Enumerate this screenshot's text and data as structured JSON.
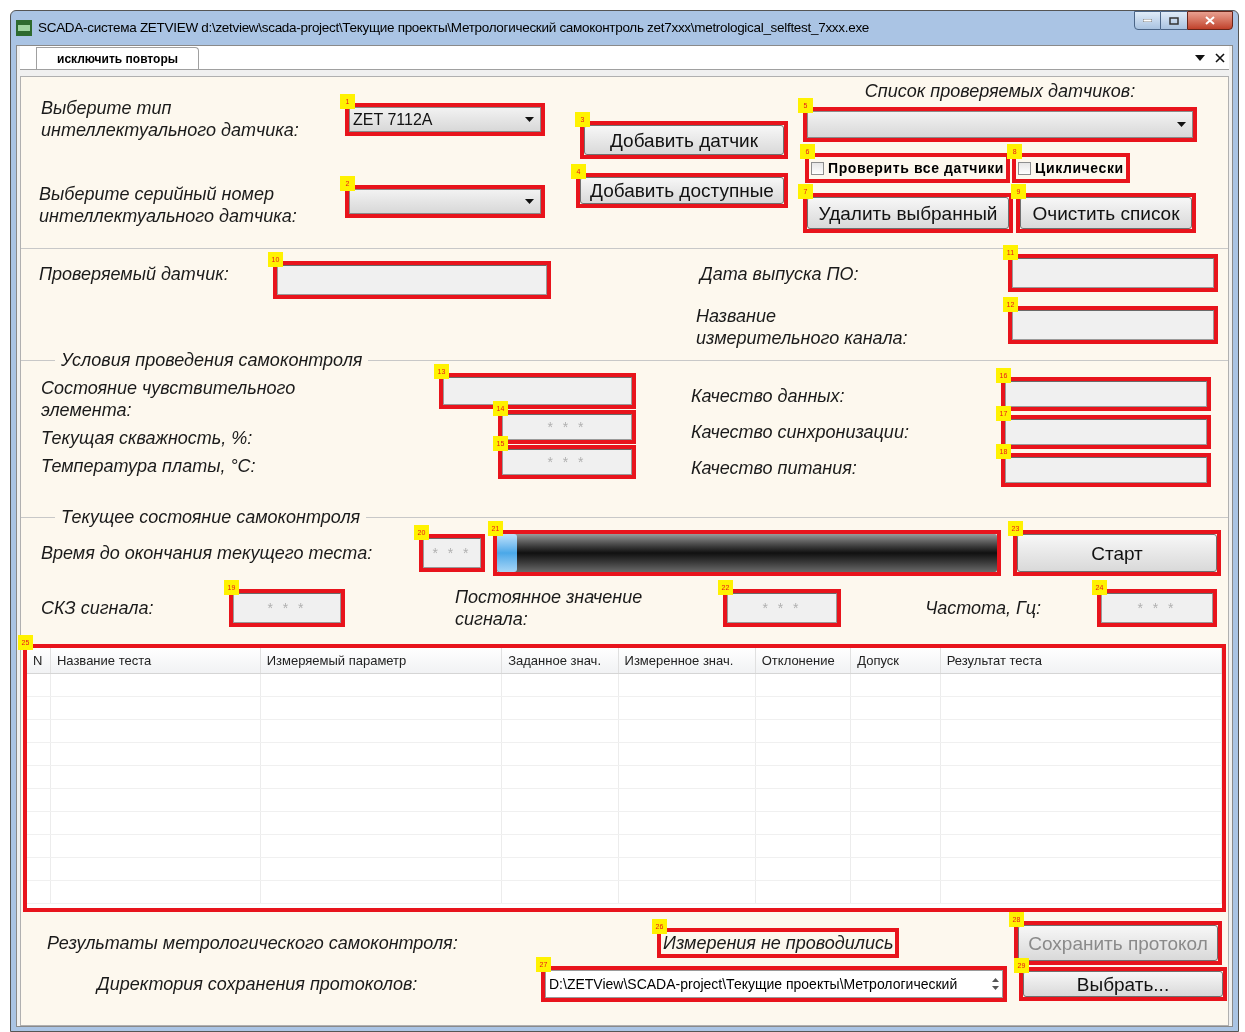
{
  "window": {
    "title": "SCADA-система ZETVIEW d:\\zetview\\scada-project\\Текущие проекты\\Метрологический самоконтроль zet7xxx\\metrological_selftest_7xxx.exe"
  },
  "tabs": [
    {
      "label": "исключить повторы",
      "selected": true
    }
  ],
  "sensor_type": {
    "label": "Выберите тип интеллектуального датчика:",
    "value": "ZET 7112A",
    "marker": "1"
  },
  "serial": {
    "label": "Выберите серийный номер интеллектуального датчика:",
    "marker": "2"
  },
  "add_sensor": {
    "label": "Добавить датчик",
    "marker": "3"
  },
  "add_available": {
    "label": "Добавить доступные",
    "marker": "4"
  },
  "sensor_list": {
    "label": "Список проверяемых датчиков:",
    "marker": "5"
  },
  "check_all": {
    "label": "Проверить все датчики",
    "checked": false,
    "marker": "6"
  },
  "delete_selected": {
    "label": "Удалить выбранный",
    "marker": "7"
  },
  "cyclic": {
    "label": "Циклически",
    "checked": false,
    "marker": "8"
  },
  "clear_list": {
    "label": "Очистить список",
    "marker": "9"
  },
  "tested_sensor": {
    "label": "Проверяемый датчик:",
    "marker": "10"
  },
  "fw_date": {
    "label": "Дата выпуска ПО:",
    "marker": "11"
  },
  "channel_name": {
    "label": "Название измерительного канала:",
    "marker": "12"
  },
  "conditions": {
    "title": "Условия проведения самоконтроля",
    "left": [
      {
        "label": "Состояние чувствительного элемента:",
        "marker": "13"
      },
      {
        "label": "Текущая скважность, %:",
        "value": "* * *",
        "marker": "14"
      },
      {
        "label": "Температура платы, °C:",
        "value": "* * *",
        "marker": "15"
      }
    ],
    "right": [
      {
        "label": "Качество данных:",
        "marker": "16"
      },
      {
        "label": "Качество синхронизации:",
        "marker": "17"
      },
      {
        "label": "Качество питания:",
        "marker": "18"
      }
    ]
  },
  "current": {
    "title": "Текущее состояние самоконтроля",
    "time_left": {
      "label": "Время до окончания текущего теста:",
      "value": "* * *",
      "marker": "20"
    },
    "progress": {
      "level": 0.04,
      "marker": "21"
    },
    "start": {
      "label": "Старт",
      "marker": "23"
    },
    "rms": {
      "label": "СКЗ сигнала:",
      "value": "* * *",
      "marker": "19"
    },
    "dc": {
      "label": "Постоянное значение сигнала:",
      "value": "* * *",
      "marker": "22"
    },
    "freq": {
      "label": "Частота, Гц:",
      "value": "* * *",
      "marker": "24"
    }
  },
  "table": {
    "marker": "25",
    "columns": [
      "N",
      "Название теста",
      "Измеряемый параметр",
      "Заданное знач.",
      "Измеренное знач.",
      "Отклонение",
      "Допуск",
      "Результат теста"
    ]
  },
  "results": {
    "label": "Результаты метрологического самоконтроля:",
    "status": "Измерения не проводились",
    "status_marker": "26"
  },
  "save": {
    "label": "Сохранить протокол",
    "disabled": true,
    "marker": "28"
  },
  "directory": {
    "label": "Директория сохранения протоколов:",
    "value": "D:\\ZETView\\SCADA-project\\Текущие проекты\\Метрологический",
    "marker": "27"
  },
  "choose": {
    "label": "Выбрать...",
    "marker": "29"
  }
}
